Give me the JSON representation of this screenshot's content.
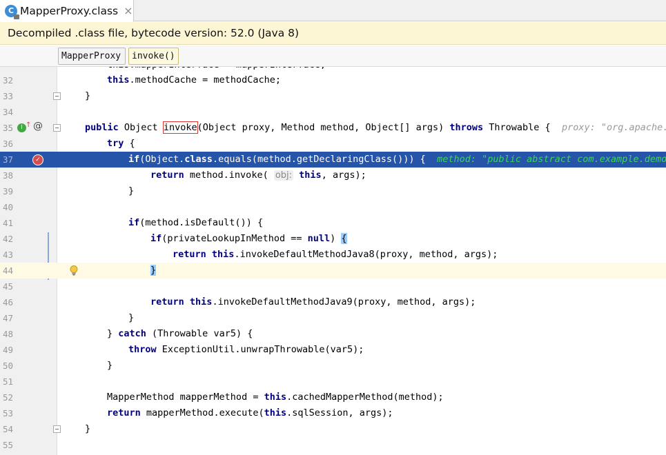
{
  "tab": {
    "icon": "class-file-icon",
    "icon_letter": "C",
    "title": "MapperProxy.class",
    "close": "×"
  },
  "notice": {
    "text": "Decompiled .class file, bytecode version: 52.0 (Java 8)"
  },
  "breadcrumbs": [
    "MapperProxy",
    "invoke()"
  ],
  "gutter_icons": {
    "implements": "implementing-method-icon",
    "annotation": "at-sign-icon",
    "breakpoint": "breakpoint-icon",
    "intention": "lightbulb-icon"
  },
  "lines": {
    "n32": "32",
    "n33": "33",
    "n34": "34",
    "n35": "35",
    "n36": "36",
    "n37": "37",
    "n38": "38",
    "n39": "39",
    "n40": "40",
    "n41": "41",
    "n42": "42",
    "n43": "43",
    "n44": "44",
    "n45": "45",
    "n46": "46",
    "n47": "47",
    "n48": "48",
    "n49": "49",
    "n50": "50",
    "n51": "51",
    "n52": "52",
    "n53": "53",
    "n54": "54",
    "n55": "55"
  },
  "code": {
    "l31": "this.mapperInterface = mapperInterface;",
    "l32_kw": "this",
    "l32_rest": ".methodCache = methodCache;",
    "l33": "}",
    "l35_kw1": "public",
    "l35_a": " Object ",
    "l35_method": "invoke",
    "l35_b": "(Object proxy, Method method, Object[] args) ",
    "l35_kw2": "throws",
    "l35_c": " Throwable {",
    "l35_hint": "proxy: \"org.apache.",
    "l36_kw": "try",
    "l36_rest": " {",
    "l37_kw1": "if",
    "l37_a": "(Object.",
    "l37_kw2": "class",
    "l37_b": ".equals(method.getDeclaringClass())) {",
    "l37_hint": "method: \"public abstract com.example.demo.",
    "l38_kw1": "return",
    "l38_a": " method.invoke( ",
    "l38_param": "obj:",
    "l38_kw2": "this",
    "l38_b": ", args);",
    "l39": "}",
    "l41_kw": "if",
    "l41_rest": "(method.isDefault()) {",
    "l42_kw1": "if",
    "l42_a": "(privateLookupInMethod == ",
    "l42_kw2": "null",
    "l42_b": ") ",
    "l42_brace": "{",
    "l43_kw1": "return",
    "l43_a": " ",
    "l43_kw2": "this",
    "l43_b": ".invokeDefaultMethodJava8(proxy, method, args);",
    "l44": "}",
    "l46_kw1": "return",
    "l46_a": " ",
    "l46_kw2": "this",
    "l46_b": ".invokeDefaultMethodJava9(proxy, method, args);",
    "l47": "}",
    "l48_a": "} ",
    "l48_kw": "catch",
    "l48_b": " (Throwable var5) {",
    "l49_kw": "throw",
    "l49_rest": " ExceptionUtil.unwrapThrowable(var5);",
    "l50": "}",
    "l52_a": "MapperMethod mapperMethod = ",
    "l52_kw": "this",
    "l52_b": ".cachedMapperMethod(method);",
    "l53_kw1": "return",
    "l53_a": " mapperMethod.execute(",
    "l53_kw2": "this",
    "l53_b": ".sqlSession, args);",
    "l54": "}"
  }
}
